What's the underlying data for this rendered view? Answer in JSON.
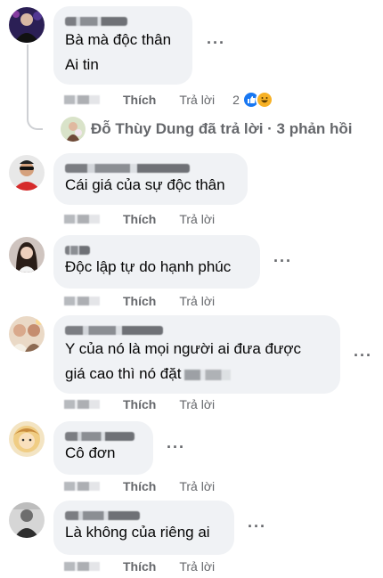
{
  "actions": {
    "like": "Thích",
    "reply": "Trả lời"
  },
  "comments": [
    {
      "text": "Bà mà độc thân\nAi tin",
      "reaction_count": "2"
    },
    {
      "text": "Cái giá của sự độc thân"
    },
    {
      "text": "Độc lập tự do hạnh phúc"
    },
    {
      "text": "Y của nó là mọi người ai đưa được\ngiá cao thì nó đặt"
    },
    {
      "text": "Cô đơn"
    },
    {
      "text": "Là không của riêng ai"
    }
  ],
  "replies_summary": "Đỗ Thùy Dung đã trả lời · 3 phản hồi",
  "colors": {
    "bubble": "#f0f2f5",
    "secondary_text": "#65676b",
    "like_blue": "#1877f2"
  }
}
